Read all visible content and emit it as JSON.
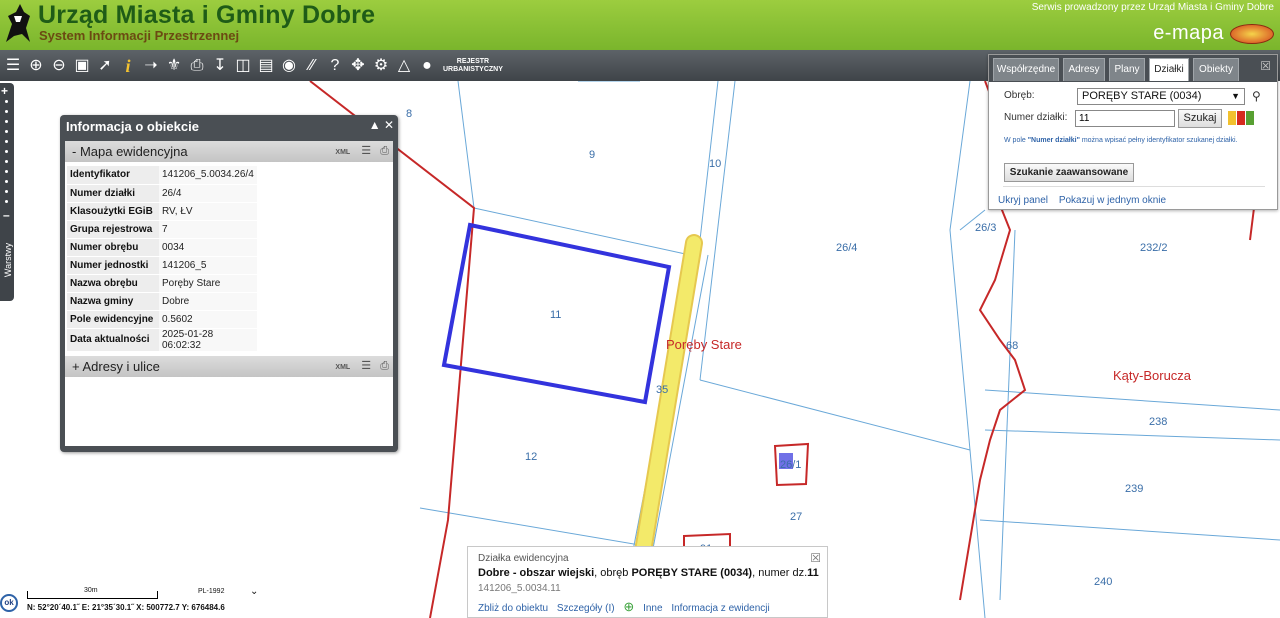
{
  "header": {
    "title": "Urząd Miasta i Gminy Dobre",
    "subtitle": "System Informacji Przestrzennej",
    "service_note": "Serwis prowadzony przez Urząd Miasta i Gminy Dobre",
    "brand": "e-mapa"
  },
  "toolbar": {
    "tools": [
      "layers-icon",
      "zoom-in-icon",
      "zoom-out-icon",
      "zoom-extent-icon",
      "pointer-icon",
      "info-icon",
      "measure-line-icon",
      "measure-area-icon",
      "print-icon",
      "download-icon",
      "export-icon",
      "legend-icon",
      "comment-icon",
      "hatch-icon",
      "help-icon",
      "pan-icon",
      "settings-icon",
      "road-icon",
      "street-view-icon"
    ],
    "rejestr_line1": "REJESTR",
    "rejestr_line2": "URBANISTYCZNY"
  },
  "layers_tab": {
    "label": "Warstwy"
  },
  "info_panel": {
    "title": "Informacja o obiekcie",
    "section1": "-  Mapa ewidencyjna",
    "section2": "+  Adresy i ulice",
    "xml": "XML",
    "attributes": [
      {
        "key": "Identyfikator",
        "value": "141206_5.0034.26/4"
      },
      {
        "key": "Numer działki",
        "value": "26/4"
      },
      {
        "key": "Klasoużytki EGiB",
        "value": "RV, ŁV"
      },
      {
        "key": "Grupa rejestrowa",
        "value": "7"
      },
      {
        "key": "Numer obrębu",
        "value": "0034"
      },
      {
        "key": "Numer jednostki",
        "value": "141206_5"
      },
      {
        "key": "Nazwa obrębu",
        "value": "Poręby Stare"
      },
      {
        "key": "Nazwa gminy",
        "value": "Dobre"
      },
      {
        "key": "Pole ewidencyjne",
        "value": "0.5602"
      },
      {
        "key": "Data aktualności",
        "value": "2025-01-28 06:02:32"
      }
    ]
  },
  "search_panel": {
    "tabs": [
      "Współrzędne",
      "Adresy",
      "Plany",
      "Działki",
      "Obiekty"
    ],
    "active_tab": "Działki",
    "obreb_label": "Obręb:",
    "obreb_value": "PORĘBY STARE (0034)",
    "numer_label": "Numer działki:",
    "numer_value": "11",
    "search_button": "Szukaj",
    "hint_prefix": "W pole ",
    "hint_bold": "\"Numer działki\"",
    "hint_suffix": " można wpisać pełny identyfikator szukanej działki.",
    "advanced_button": "Szukanie zaawansowane",
    "hide_panel": "Ukryj panel",
    "single_window": "Pokazuj w jednym oknie",
    "color_swatches": [
      "#f2c12e",
      "#d62b1f",
      "#58a032"
    ]
  },
  "map": {
    "plot_labels": [
      "8",
      "9",
      "10",
      "26/4",
      "26/3",
      "232/2",
      "11",
      "68",
      "35",
      "12",
      "238",
      "239",
      "27",
      "240",
      "91",
      "26/1"
    ],
    "places": [
      "Poręby Stare",
      "Kąty-Borucza"
    ],
    "selection_color": "#3333dd",
    "road_color": "#f3ea6a",
    "boundary_color": "#c62828",
    "parcel_line_color": "#6aa8d8"
  },
  "popup": {
    "type": "Działka ewidencyjna",
    "desc_bold1": "Dobre - obszar wiejski",
    "desc_mid": ", obręb ",
    "desc_bold2": "PORĘBY STARE (0034)",
    "desc_tail": ", numer dz.",
    "desc_bold3": "11",
    "id": "141206_5.0034.11",
    "links": [
      "Zbliż do obiektu",
      "Szczegóły (I)",
      "Inne",
      "Informacja z ewidencji"
    ]
  },
  "status": {
    "ok": "ok",
    "scale": "30m",
    "projection": "PL-1992",
    "coords": "N: 52°20´40.1˝ E: 21°35´30.1˝  X: 500772.7  Y: 676484.6"
  }
}
